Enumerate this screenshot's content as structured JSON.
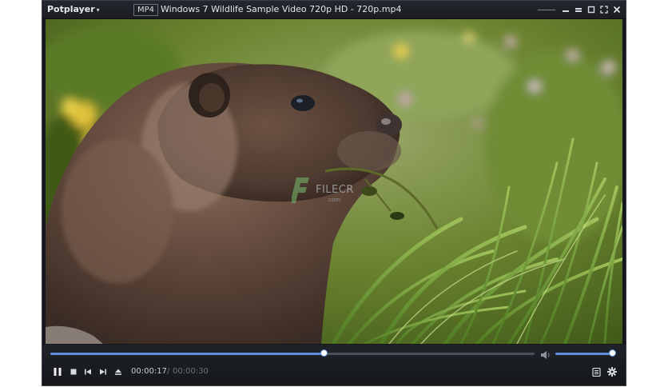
{
  "app": {
    "name": "Potplayer",
    "menu_caret": "▾"
  },
  "titlebar": {
    "format_badge": "MP4",
    "file_title": "Windows 7 Wildlife Sample Video 720p HD - 720p.mp4"
  },
  "window_controls": [
    "minimize-icon",
    "restore-icon",
    "maximize-icon",
    "fullscreen-icon",
    "close-icon"
  ],
  "video": {
    "watermark_text": "FILECR",
    "watermark_sub": ".com"
  },
  "playback": {
    "current_time": "00:00:17",
    "separator": "/",
    "total_time": "00:00:30",
    "progress": 0.5667,
    "volume": 1.0,
    "state": "playing"
  },
  "colors": {
    "accent": "#5f8fe0",
    "background": "#15171c",
    "text": "#e6e8ec"
  }
}
